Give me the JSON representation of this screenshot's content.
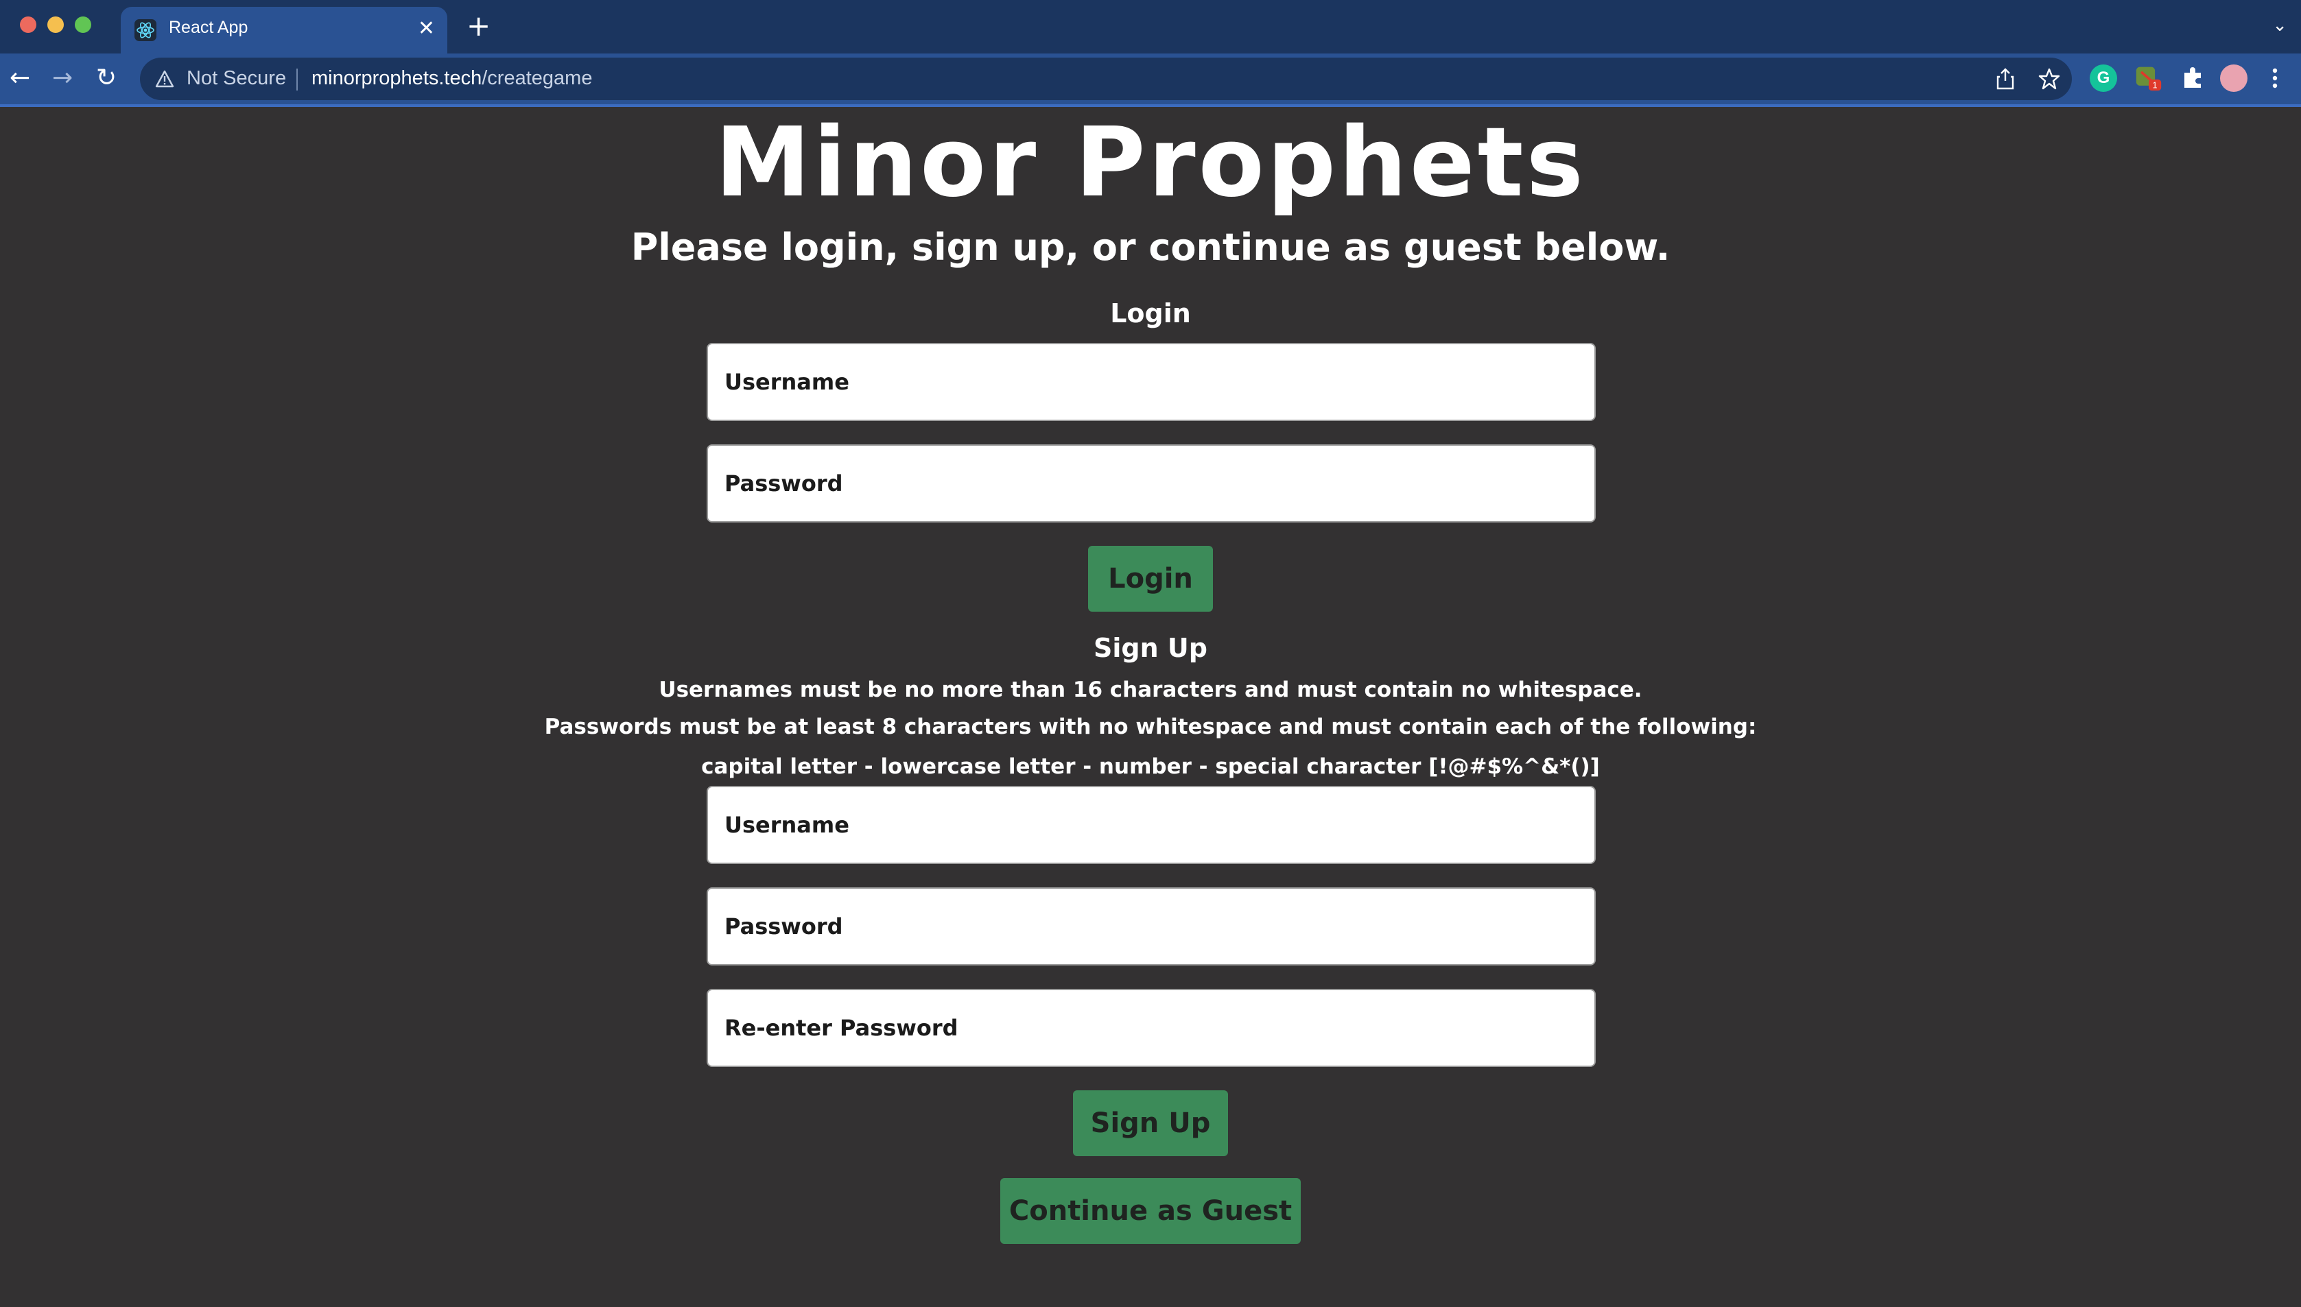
{
  "browser": {
    "tab_title": "React App",
    "not_secure_label": "Not Secure",
    "url_host": "minorprophets.tech",
    "url_path": "/creategame",
    "extension_badge": "1"
  },
  "page": {
    "title": "Minor Prophets",
    "subtitle": "Please login, sign up, or continue as guest below.",
    "login": {
      "heading": "Login",
      "username_placeholder": "Username",
      "password_placeholder": "Password",
      "button_label": "Login"
    },
    "signup": {
      "heading": "Sign Up",
      "rule_username": "Usernames must be no more than 16 characters and must contain no whitespace.",
      "rule_password": "Passwords must be at least 8 characters with no whitespace and must contain each of the following:",
      "rule_chars": "capital letter - lowercase letter - number - special character [!@#$%^&*()]",
      "username_placeholder": "Username",
      "password_placeholder": "Password",
      "reenter_placeholder": "Re-enter Password",
      "button_label": "Sign Up"
    },
    "guest_button_label": "Continue as Guest"
  },
  "colors": {
    "background": "#333132",
    "button": "#3c8b59",
    "chrome_tab_bar": "#1b355f",
    "chrome_toolbar": "#2a5293"
  }
}
